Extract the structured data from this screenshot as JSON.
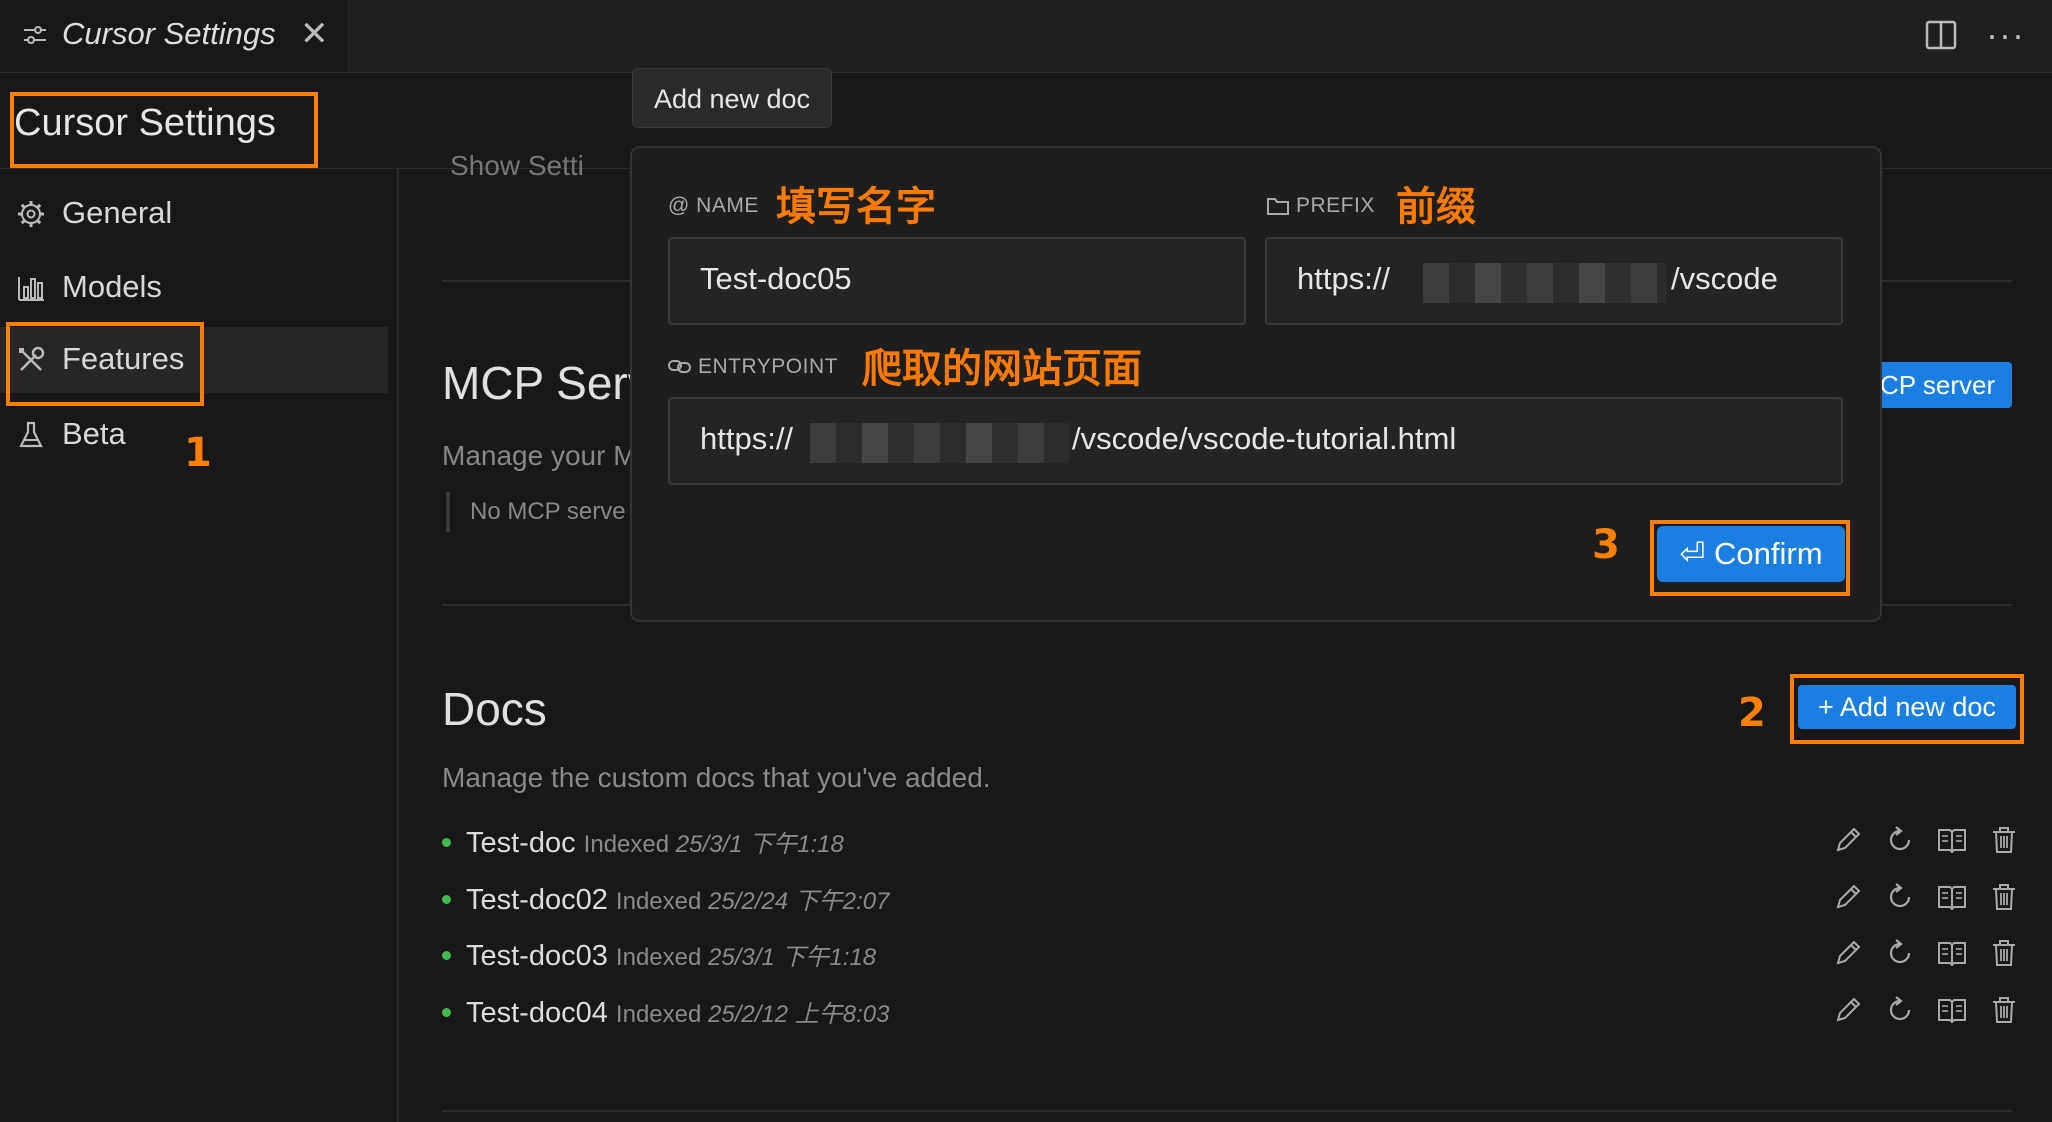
{
  "tab": {
    "title": "Cursor Settings",
    "close": "✕",
    "more": "···"
  },
  "page": {
    "title": "Cursor Settings"
  },
  "sidebar": {
    "items": [
      {
        "label": "General"
      },
      {
        "label": "Models"
      },
      {
        "label": "Features"
      },
      {
        "label": "Beta"
      }
    ]
  },
  "mcp": {
    "title": "MCP Serv",
    "description": "Manage your M",
    "empty": "No MCP serve",
    "button": "CP server",
    "show_settings": "Show Setti"
  },
  "docs": {
    "title": "Docs",
    "description": "Manage the custom docs that you've added.",
    "add_button": "+ Add new doc",
    "items": [
      {
        "name": "Test-doc",
        "indexed": "Indexed",
        "date": "25/3/1 下午1:18"
      },
      {
        "name": "Test-doc02",
        "indexed": "Indexed",
        "date": "25/2/24 下午2:07"
      },
      {
        "name": "Test-doc03",
        "indexed": "Indexed",
        "date": "25/3/1 下午1:18"
      },
      {
        "name": "Test-doc04",
        "indexed": "Indexed",
        "date": "25/2/12 上午8:03"
      }
    ]
  },
  "tooltip": {
    "text": "Add new doc"
  },
  "dialog": {
    "name_label": "@ NAME",
    "name_value": "Test-doc05",
    "prefix_label": "PREFIX",
    "prefix_value_start": "https://",
    "prefix_value_end": "/vscode",
    "entrypoint_label": "ENTRYPOINT",
    "entrypoint_value_start": "https://",
    "entrypoint_value_end": "/vscode/vscode-tutorial.html",
    "confirm": "⏎ Confirm"
  },
  "annotations": {
    "name_hint": "填写名字",
    "prefix_hint": "前缀",
    "entrypoint_hint": "爬取的网站页面",
    "step1": "1",
    "step2": "2",
    "step3": "3"
  },
  "colors": {
    "accent": "#1a7fe0",
    "annotation": "#ff8000",
    "status": "#3fb950",
    "background": "#181818"
  }
}
